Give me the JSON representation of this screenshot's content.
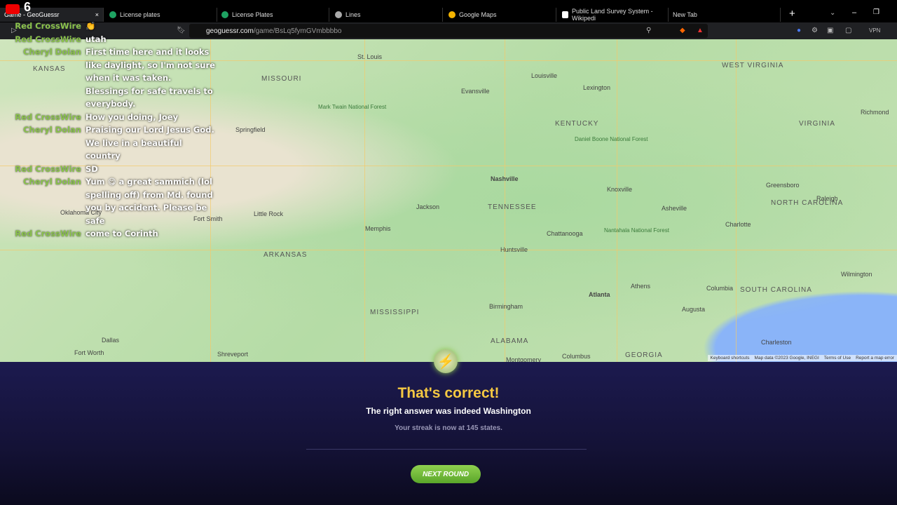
{
  "overlay": {
    "viewer_count": "6"
  },
  "browser": {
    "tabs": [
      {
        "label": "Game - GeoGuessr",
        "active": true
      },
      {
        "label": "License plates"
      },
      {
        "label": "License Plates"
      },
      {
        "label": "Lines"
      },
      {
        "label": "Google Maps"
      },
      {
        "label": "Public Land Survey System - Wikipedi"
      },
      {
        "label": "New Tab"
      }
    ],
    "url_domain": "geoguessr.com",
    "url_path": "/game/BsLq5fymGVmbbbbo",
    "vpn_label": "VPN",
    "new_tab": "+",
    "minimize": "–",
    "restore": "❐",
    "close_tab": "×"
  },
  "chat": [
    {
      "name": "Red CrossWire",
      "msg": "👏"
    },
    {
      "name": "Red CrossWire",
      "msg": "utah"
    },
    {
      "name": "Cheryl Dolan",
      "msg": "First time here and it looks like daylight, so I'm not sure when it was taken. Blessings for safe travels to everybody."
    },
    {
      "name": "Red CrossWire",
      "msg": "How you doing, Joey"
    },
    {
      "name": "Cheryl Dolan",
      "msg": "Praising our Lord Jesus God. We live in a beautiful country"
    },
    {
      "name": "Red CrossWire",
      "msg": "SD"
    },
    {
      "name": "Cheryl Dolan",
      "msg": "Yum 😋 a great sammich (lol spelling off) from Md. found you by accident. Please be safe"
    },
    {
      "name": "Red CrossWire",
      "msg": "come to Corinth"
    }
  ],
  "map": {
    "labels": [
      "St. Louis",
      "MISSOURI",
      "KANSAS",
      "Springfield",
      "Louisville",
      "Lexington",
      "KENTUCKY",
      "WEST VIRGINIA",
      "VIRGINIA",
      "Richmond",
      "Nashville",
      "TENNESSEE",
      "Knoxville",
      "Chattanooga",
      "NORTH CAROLINA",
      "Charlotte",
      "Raleigh",
      "Memphis",
      "ARKANSAS",
      "Oklahoma City",
      "Dallas",
      "Fort Worth",
      "MISSISSIPPI",
      "ALABAMA",
      "Birmingham",
      "Huntsville",
      "Atlanta",
      "Athens",
      "GEORGIA",
      "SOUTH CAROLINA",
      "Columbia",
      "Charleston",
      "Augusta",
      "Jackson",
      "Little Rock",
      "Fort Smith",
      "Evansville",
      "Asheville",
      "Greensboro",
      "Wilmington",
      "Shreveport",
      "Montgomery",
      "Columbus",
      "Mark Twain National Forest",
      "Daniel Boone National Forest",
      "Nantahala National Forest"
    ],
    "attribution": [
      "Keyboard shortcuts",
      "Map data ©2023 Google, INEGI",
      "Terms of Use",
      "Report a map error"
    ]
  },
  "result": {
    "title": "That's correct!",
    "subtitle": "The right answer was indeed Washington",
    "streak": "Your streak is now at 145 states.",
    "next_button": "NEXT ROUND",
    "bolt_icon": "⚡"
  },
  "colors": {
    "title": "#f5c842",
    "button": "#6fbf3a",
    "panel": "#1c1a4f",
    "chat_name": "#8bc34a"
  }
}
